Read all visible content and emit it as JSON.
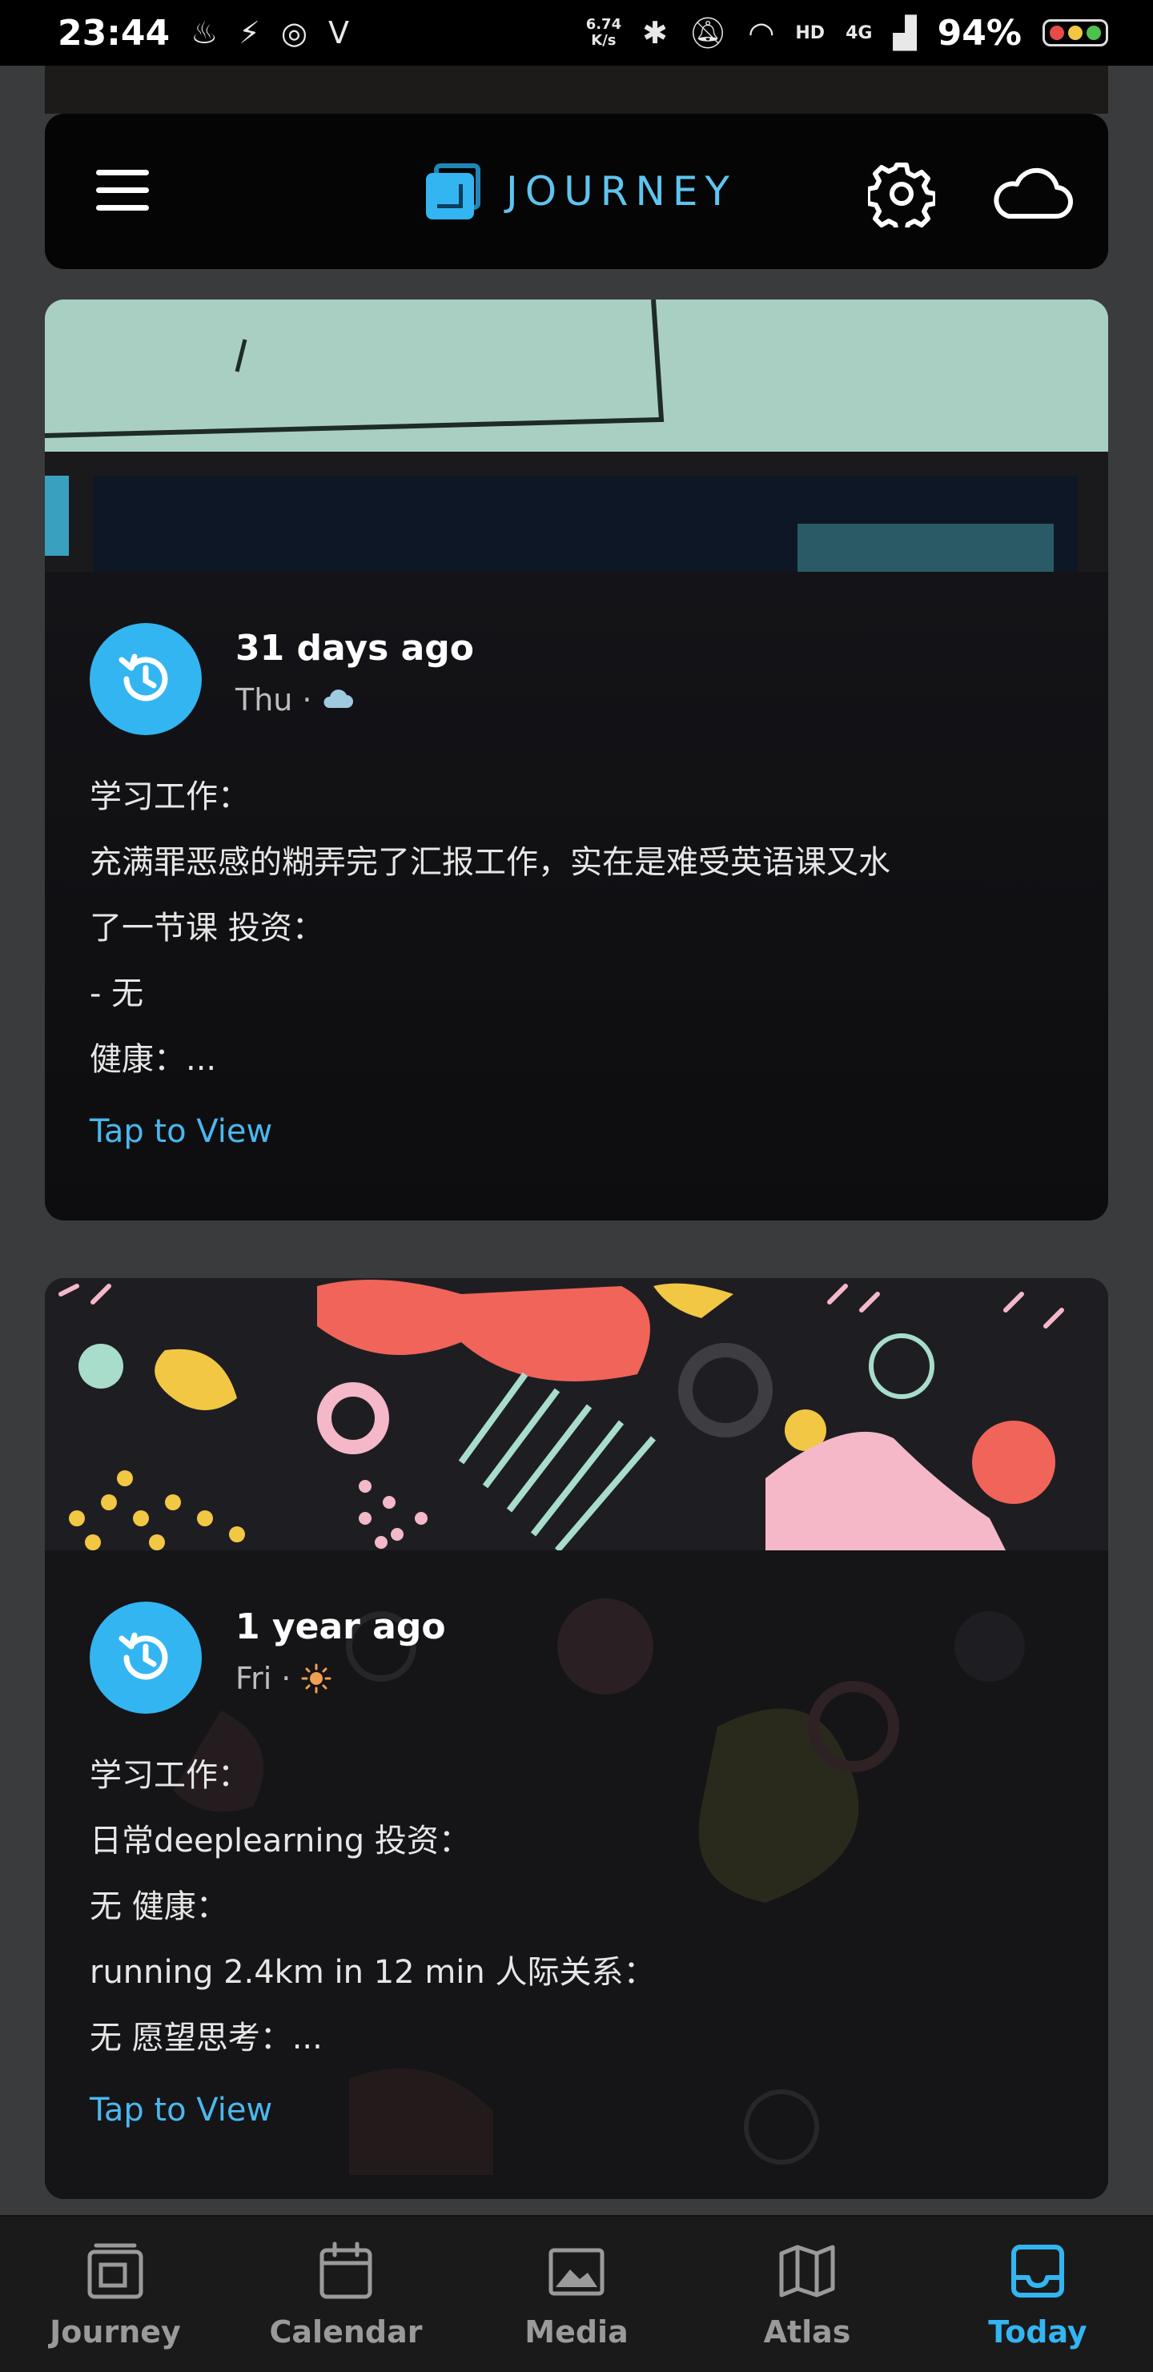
{
  "status_bar": {
    "time": "23:44",
    "speed_value": "6.74",
    "speed_unit": "K/s",
    "network_hd": "HD",
    "network_type": "4G",
    "battery_percent": "94%",
    "left_icons": [
      "notification-icon",
      "flash-icon",
      "messenger-icon",
      "app-v-icon"
    ],
    "right_icons": [
      "bluetooth-icon",
      "mute-icon",
      "wifi-icon",
      "signal-icon"
    ]
  },
  "header": {
    "app_name": "JOURNEY",
    "menu_icon": "hamburger-menu-icon",
    "settings_icon": "gear-icon",
    "sync_icon": "cloud-icon",
    "accent": "#33b5f2"
  },
  "cards": [
    {
      "ago": "31 days ago",
      "day": "Thu",
      "separator": "·",
      "weather_icon": "cloud-icon",
      "lines": [
        "学习工作：",
        "充满罪恶感的糊弄完了汇报工作，实在是难受英语课又水",
        "了一节课 投资：",
        "- 无",
        "健康：..."
      ],
      "tap_label": "Tap to View"
    },
    {
      "ago": "1 year ago",
      "day": "Fri",
      "separator": "·",
      "weather_icon": "sun-icon",
      "lines": [
        "学习工作：",
        "日常deeplearning 投资：",
        "无 健康：",
        "running 2.4km in 12 min 人际关系：",
        "无 愿望思考：..."
      ],
      "tap_label": "Tap to View"
    }
  ],
  "bottom_nav": {
    "items": [
      {
        "label": "Journey",
        "icon": "journey-icon"
      },
      {
        "label": "Calendar",
        "icon": "calendar-icon"
      },
      {
        "label": "Media",
        "icon": "image-icon"
      },
      {
        "label": "Atlas",
        "icon": "map-icon"
      },
      {
        "label": "Today",
        "icon": "inbox-icon"
      }
    ],
    "active": "Today",
    "active_color": "#33b5f2"
  }
}
